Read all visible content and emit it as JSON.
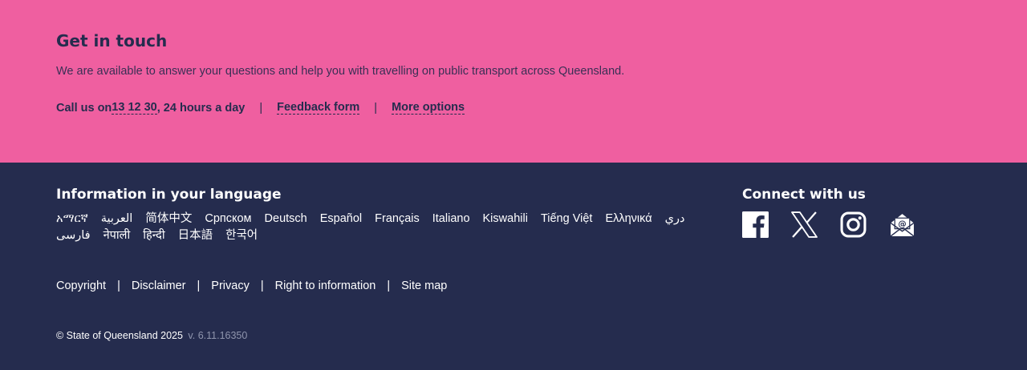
{
  "contact": {
    "title": "Get in touch",
    "lead": "We are available to answer your questions and help you with travelling on public transport across Queensland.",
    "call_prefix": "Call us on ",
    "phone": "13 12 30",
    "call_suffix": ", 24 hours a day",
    "separator": "|",
    "feedback_label": "Feedback form",
    "more_label": "More options"
  },
  "languages": {
    "title": "Information in your language",
    "items": [
      "አማርኛ",
      "العربية",
      "简体中文",
      "Српском",
      "Deutsch",
      "Español",
      "Français",
      "Italiano",
      "Kiswahili",
      "Tiếng Việt",
      "Ελληνικά",
      "دري",
      "فارسی",
      "नेपाली",
      "हिन्दी",
      "日本語",
      "한국어"
    ]
  },
  "connect": {
    "title": "Connect with us",
    "icons": [
      "facebook-icon",
      "x-icon",
      "instagram-icon",
      "email-icon"
    ]
  },
  "legal": {
    "separator": "|",
    "links": [
      "Copyright",
      "Disclaimer",
      "Privacy",
      "Right to information",
      "Site map"
    ]
  },
  "copyright": {
    "text": "© State of Queensland 2025",
    "version": "v. 6.11.16350"
  },
  "colors": {
    "pink": "#ef5fa0",
    "navy": "#252c4e"
  }
}
